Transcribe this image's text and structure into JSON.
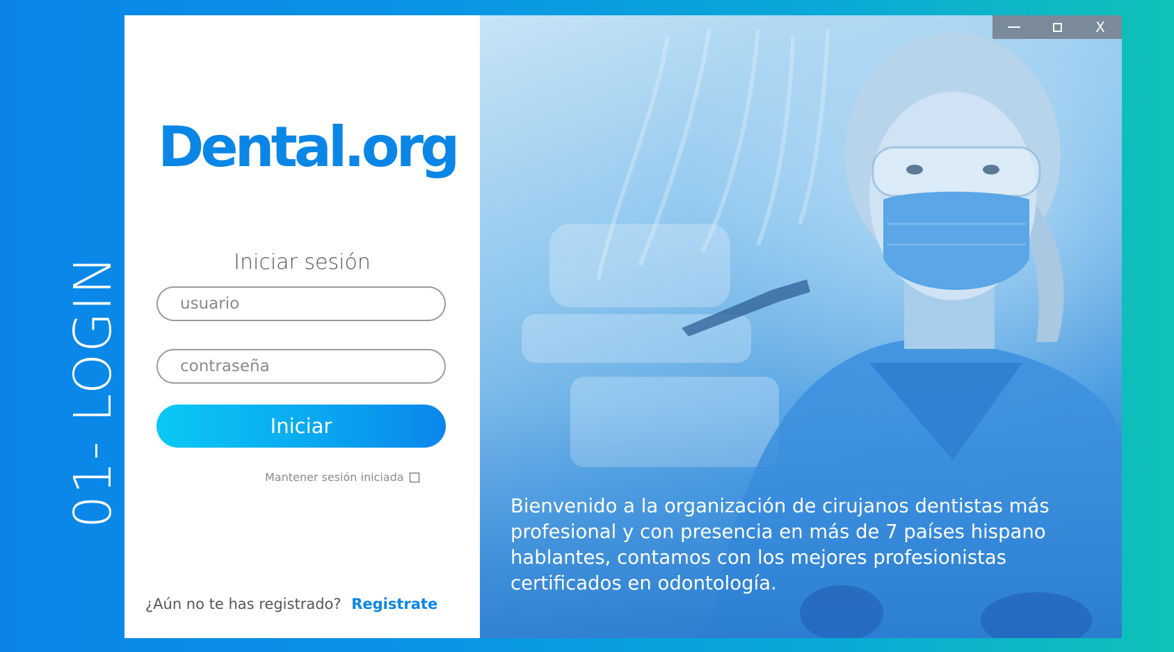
{
  "side_label": "01- LOGIN",
  "app": {
    "logo_text": "Dental.org",
    "brand_color": "#0a86e6"
  },
  "login": {
    "title": "Iniciar sesión",
    "username_placeholder": "usuario",
    "password_placeholder": "contraseña",
    "submit_label": "Iniciar",
    "keep_session_label": "Mantener sesión iniciada",
    "keep_session_checked": false
  },
  "register": {
    "prompt": "¿Aún no te has registrado?",
    "link_label": "Registrate"
  },
  "hero": {
    "welcome_text": "Bienvenido a la organización de cirujanos dentistas más profesional y con presencia en más de 7 países hispano hablantes,  contamos con los mejores profesionistas certificados en odontología."
  },
  "window_controls": {
    "minimize_icon": "minimize-icon",
    "maximize_icon": "maximize-icon",
    "close_label": "X"
  }
}
